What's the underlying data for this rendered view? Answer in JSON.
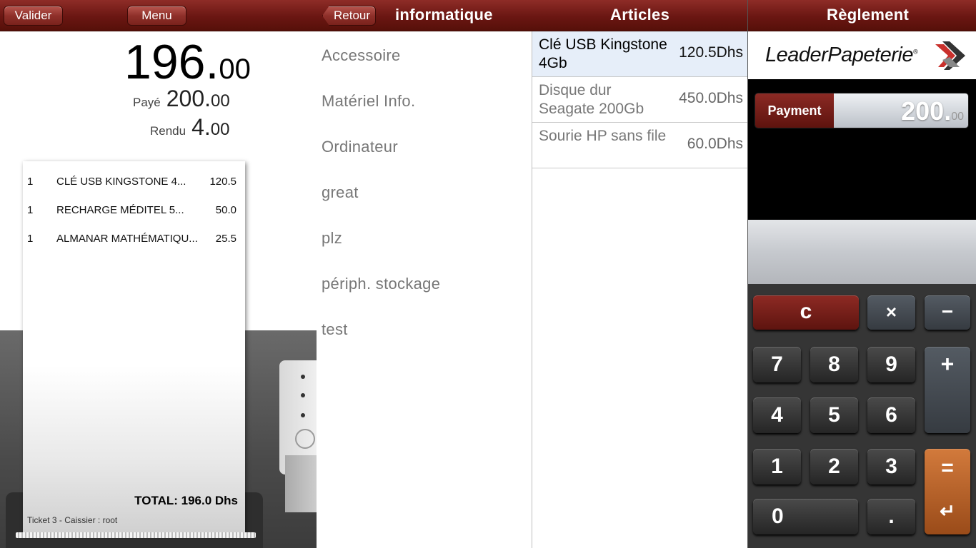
{
  "left": {
    "validate_label": "Valider",
    "menu_label": "Menu",
    "total_int": "196.",
    "total_dec": "00",
    "paid_label": "Payé",
    "paid_int": "200.",
    "paid_dec": "00",
    "change_label": "Rendu",
    "change_int": "4.",
    "change_dec": "00"
  },
  "receipt": {
    "lines": [
      {
        "qty": "1",
        "name": "CLÉ USB KINGSTONE 4...",
        "price": "120.5"
      },
      {
        "qty": "1",
        "name": "RECHARGE  MÉDITEL 5...",
        "price": "50.0"
      },
      {
        "qty": "1",
        "name": "ALMANAR MATHÉMATIQU...",
        "price": "25.5"
      }
    ],
    "total": "TOTAL:  196.0 Dhs",
    "footer": "Ticket 3 - Caissier : root"
  },
  "categories": {
    "back_label": "Retour",
    "title": "informatique",
    "items": [
      "Accessoire",
      "Matériel Info.",
      "Ordinateur",
      "great",
      "plz",
      "périph. stockage",
      "test"
    ]
  },
  "articles": {
    "title": "Articles",
    "items": [
      {
        "name": "Clé USB Kingstone 4Gb",
        "price": "120.5Dhs",
        "selected": true
      },
      {
        "name": "Disque dur Seagate 200Gb",
        "price": "450.0Dhs",
        "selected": false
      },
      {
        "name": "Sourie HP sans file",
        "price": "60.0Dhs",
        "selected": false
      }
    ]
  },
  "payment": {
    "title": "Règlement",
    "logo_text": "LeaderPapeterie",
    "logo_reg": "®",
    "field_label": "Payment",
    "field_int": "200.",
    "field_dec": "00",
    "keys": {
      "clear": "c",
      "multiply": "×",
      "minus": "−",
      "plus": "+",
      "equals": "=",
      "enter": "↵",
      "dot": ".",
      "k7": "7",
      "k8": "8",
      "k9": "9",
      "k4": "4",
      "k5": "5",
      "k6": "6",
      "k1": "1",
      "k2": "2",
      "k3": "3",
      "k0": "0"
    }
  },
  "colors": {
    "bar": "#6a1612",
    "selected_row": "#e6eef9",
    "accent_orange": "#c26a2e"
  }
}
